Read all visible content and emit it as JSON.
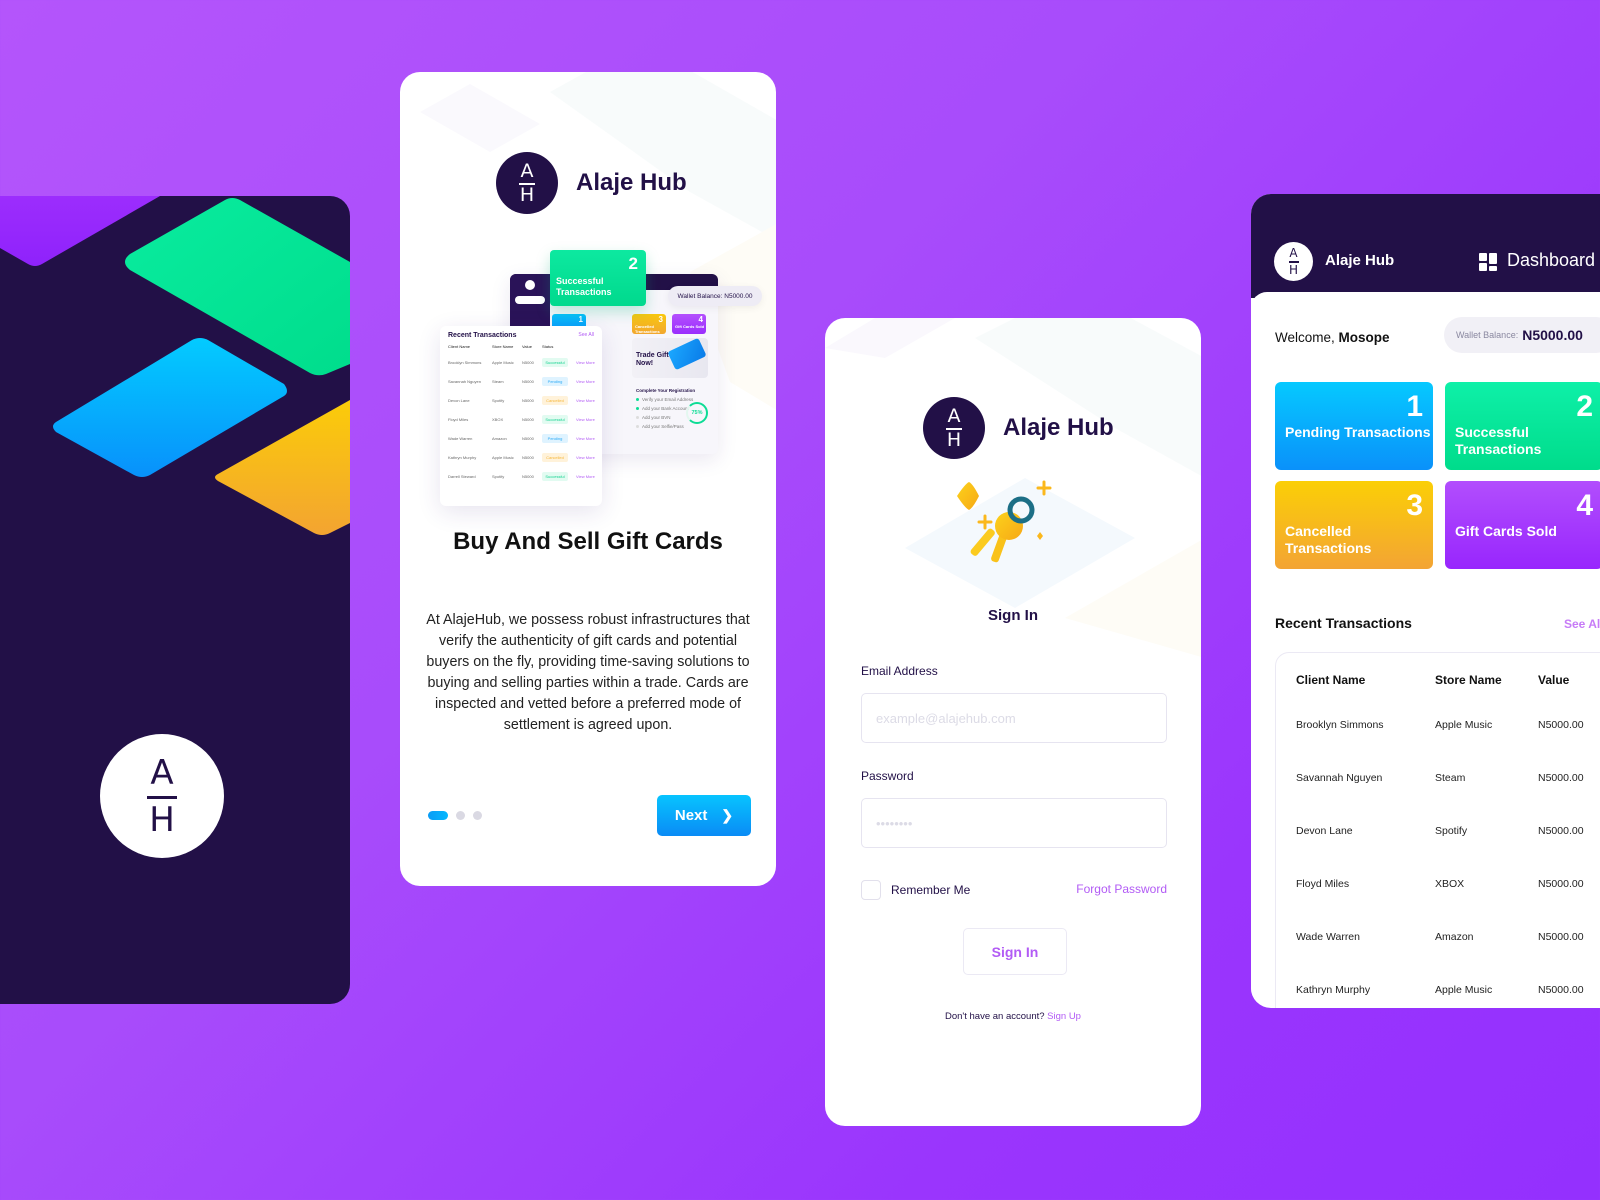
{
  "brand": {
    "name": "Alaje Hub",
    "logo_top": "A",
    "logo_bottom": "H"
  },
  "colors": {
    "background": "#a84cfb",
    "navy": "#221047",
    "accent_purple": "#b25bf5",
    "green": "#05e49a",
    "blue": "#07b4ff",
    "yellow": "#f9c80e",
    "violet": "#9a30fd"
  },
  "splash": {
    "logo_icon": "alaje-hub-logo"
  },
  "onboarding": {
    "title": "Buy And Sell Gift Cards",
    "description": "At AlajeHub, we possess robust infrastructures that verify the authenticity of gift cards and potential buyers on the fly, providing time-saving solutions to buying and selling parties within a trade. Cards are inspected and vetted before a preferred mode of settlement is agreed upon.",
    "page_total": 3,
    "page_active": 1,
    "next_label": "Next",
    "next_icon": "chevron-right-icon",
    "preview": {
      "highlight_number": "2",
      "highlight_label": "Successful Transactions",
      "wallet": "Wallet Balance: N5000.00",
      "mini_cards": [
        {
          "number": "1",
          "label": ""
        },
        {
          "number": "3",
          "label": "Cancelled Transactions"
        },
        {
          "number": "4",
          "label": "Gift Cards Sold"
        }
      ],
      "trade_banner": "Trade Gift Cards Now!",
      "registration_title": "Complete Your Registration",
      "registration_items": [
        "Verify your Email Address",
        "Add your Bank Account",
        "Add your BVN",
        "Add your Selfie/Pass"
      ],
      "registration_progress": "75%",
      "table_title": "Recent Transactions",
      "table_see_all": "See All",
      "table_headers": [
        "Client Name",
        "Store Name",
        "Value",
        "Status",
        ""
      ],
      "table_rows": [
        [
          "Brooklyn Simmons",
          "Apple Music",
          "N5000",
          "Successful",
          "View More"
        ],
        [
          "Savannah Nguyen",
          "Steam",
          "N5000",
          "Pending",
          "View More"
        ],
        [
          "Devon Lane",
          "Spotify",
          "N5000",
          "Cancelled",
          "View More"
        ],
        [
          "Floyd Miles",
          "XBOX",
          "N5000",
          "Successful",
          "View More"
        ],
        [
          "Wade Warren",
          "Amazon",
          "N5000",
          "Pending",
          "View More"
        ],
        [
          "Kathryn Murphy",
          "Apple Music",
          "N5000",
          "Cancelled",
          "View More"
        ],
        [
          "Darrell Steward",
          "Spotify",
          "N5000",
          "Successful",
          "View More"
        ]
      ]
    }
  },
  "signin": {
    "illustration": "keys-icon",
    "title": "Sign In",
    "email_label": "Email Address",
    "email_placeholder": "example@alajehub.com",
    "email_value": "",
    "password_label": "Password",
    "password_placeholder": "••••••••",
    "password_value": "",
    "remember_label": "Remember Me",
    "remember_checked": false,
    "forgot_label": "Forgot Password",
    "submit_label": "Sign In",
    "signup_prompt": "Don't have an account?",
    "signup_link": "Sign Up"
  },
  "dashboard": {
    "nav_label": "Dashboard",
    "nav_icon": "dashboard-grid-icon",
    "welcome_prefix": "Welcome,",
    "user_name": "Mosope",
    "wallet_label": "Wallet Balance:",
    "wallet_value": "N5000.00",
    "stats": [
      {
        "number": "1",
        "label": "Pending Transactions"
      },
      {
        "number": "2",
        "label": "Successful Transactions"
      },
      {
        "number": "3",
        "label": "Cancelled Transactions"
      },
      {
        "number": "4",
        "label": "Gift Cards Sold"
      }
    ],
    "recent_title": "Recent Transactions",
    "see_all": "See All",
    "table_headers": [
      "Client Name",
      "Store Name",
      "Value"
    ],
    "table_rows": [
      [
        "Brooklyn Simmons",
        "Apple Music",
        "N5000.00"
      ],
      [
        "Savannah Nguyen",
        "Steam",
        "N5000.00"
      ],
      [
        "Devon Lane",
        "Spotify",
        "N5000.00"
      ],
      [
        "Floyd Miles",
        "XBOX",
        "N5000.00"
      ],
      [
        "Wade Warren",
        "Amazon",
        "N5000.00"
      ],
      [
        "Kathryn Murphy",
        "Apple Music",
        "N5000.00"
      ]
    ]
  }
}
